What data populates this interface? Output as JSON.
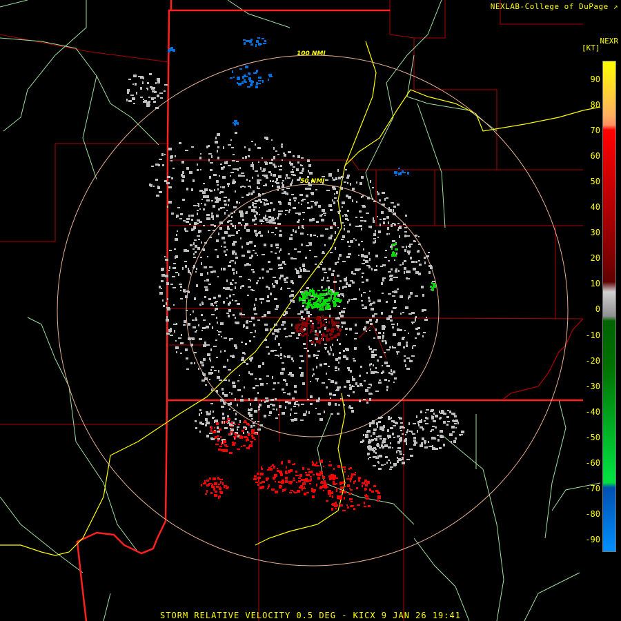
{
  "header": {
    "credit": "NEXLAB-College of DuPage",
    "credit_icon": "external-link-icon",
    "product": "NEXR",
    "unit": "[KT]"
  },
  "rings": [
    {
      "label": "100 NMI"
    },
    {
      "label": "50 NMI"
    }
  ],
  "legend": {
    "ticks": [
      "90",
      "80",
      "70",
      "60",
      "50",
      "40",
      "30",
      "20",
      "10",
      "0",
      "-10",
      "-20",
      "-30",
      "-40",
      "-50",
      "-60",
      "-70",
      "-80",
      "-90"
    ],
    "colors": {
      "inbound_high": "#ff0000",
      "inbound_low": "#8b0000",
      "near_zero": "#c0c0c0",
      "outbound_low": "#006400",
      "outbound_high": "#00dd00",
      "outbound_very_high": "#0070dd",
      "background": "#000000",
      "boundary_state": "#ff2020",
      "boundary_county": "#b00000",
      "rivers": "#a0e0a0",
      "highway": "#ffff00",
      "range_ring": "#e8b090"
    }
  },
  "caption": "STORM RELATIVE VELOCITY 0.5 DEG - KICX 9 JAN 26 19:41"
}
